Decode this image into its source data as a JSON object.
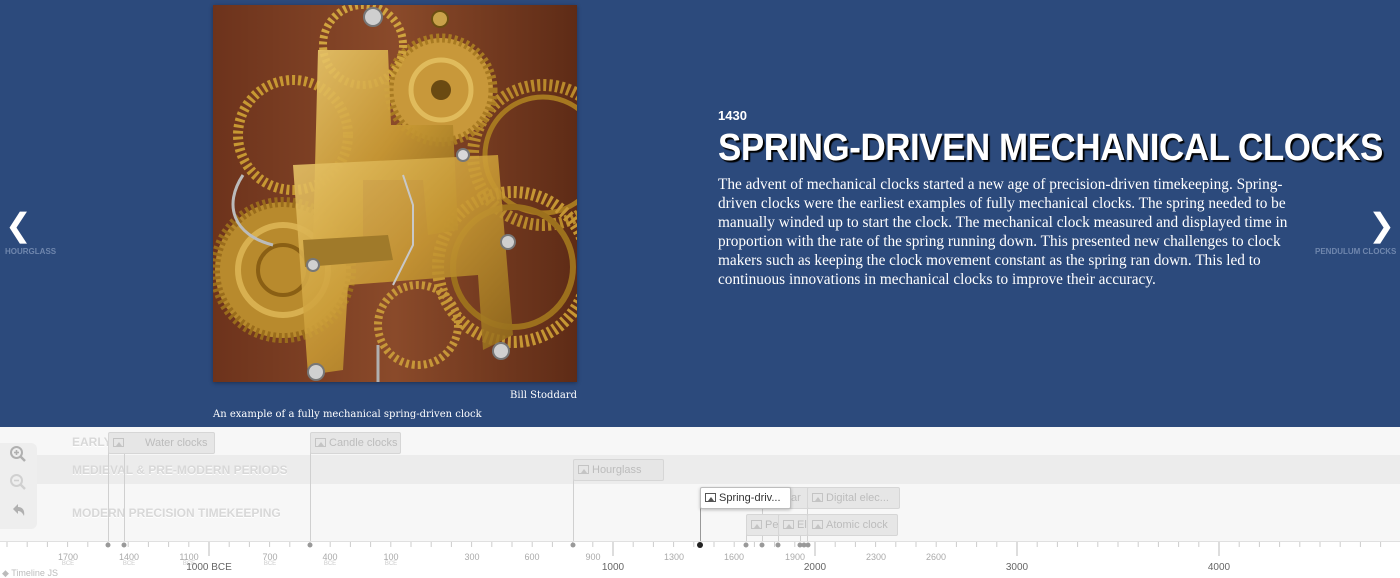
{
  "slide": {
    "date": "1430",
    "headline": "SPRING-DRIVEN MECHANICAL CLOCKS",
    "body": "The advent of mechanical clocks started a new age of precision-driven timekeeping. Spring-driven clocks were the earliest examples of fully mechanical clocks. The spring needed to be manually winded up to start the clock. The mechanical clock measured and displayed time in proportion with the rate of the spring running down. This presented new challenges to clock makers such as keeping the clock movement constant as the spring ran down. This led to continuous innovations in mechanical clocks to improve their accuracy.",
    "media_credit": "Bill Stoddard",
    "media_caption": "An example of a fully mechanical spring-driven clock"
  },
  "nav": {
    "prev_label": "HOURGLASS",
    "next_label": "PENDULUM CLOCKS",
    "prev_icon": "chevron-left-icon",
    "next_icon": "chevron-right-icon"
  },
  "groups": {
    "early": "EARLY",
    "medieval": "MEDIEVAL & PRE-MODERN PERIODS",
    "modern": "MODERN PRECISION TIMEKEEPING"
  },
  "events": {
    "water_clocks": "Water clocks",
    "candle_clocks": "Candle clocks",
    "hourglass": "Hourglass",
    "spring_driven": "Spring-driv...",
    "modern_a": "ar",
    "digital": "Digital elec...",
    "pendulum": "Pe",
    "electric": "El",
    "atomic": "Atomic clock"
  },
  "axis": {
    "minor": [
      {
        "label": "1700",
        "era": "BCE"
      },
      {
        "label": "1400",
        "era": "BCE"
      },
      {
        "label": "1100",
        "era": "BCE"
      },
      {
        "label": "700",
        "era": "BCE"
      },
      {
        "label": "400",
        "era": "BCE"
      },
      {
        "label": "100",
        "era": "BCE"
      },
      {
        "label": "300",
        "era": ""
      },
      {
        "label": "600",
        "era": ""
      },
      {
        "label": "900",
        "era": ""
      },
      {
        "label": "1300",
        "era": ""
      },
      {
        "label": "1600",
        "era": ""
      },
      {
        "label": "1900",
        "era": ""
      },
      {
        "label": "2300",
        "era": ""
      },
      {
        "label": "2600",
        "era": ""
      }
    ],
    "major": [
      "1000 BCE",
      "1000",
      "2000",
      "3000",
      "4000"
    ]
  },
  "branding": "Timeline JS",
  "colors": {
    "slider_bg": "#2c4a7c",
    "timenav_bg": "#f4f4f4"
  }
}
